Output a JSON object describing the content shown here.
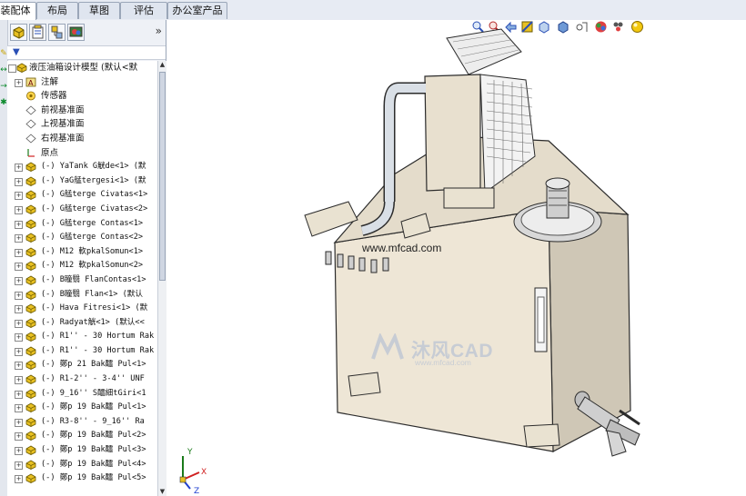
{
  "tabs": [
    {
      "label": "装配体"
    },
    {
      "label": "布局"
    },
    {
      "label": "草图"
    },
    {
      "label": "评估"
    },
    {
      "label": "办公室产品"
    }
  ],
  "panel": {
    "root_label": "液压油箱设计模型  (默认<默",
    "expand_symbol": "»"
  },
  "tree": [
    {
      "type": "annot",
      "label": "注解"
    },
    {
      "type": "sensor",
      "label": "传感器"
    },
    {
      "type": "plane",
      "label": "前视基准面"
    },
    {
      "type": "plane",
      "label": "上视基准面"
    },
    {
      "type": "plane",
      "label": "右视基准面"
    },
    {
      "type": "origin",
      "label": "原点"
    },
    {
      "type": "part",
      "label": "(-) YaTank G觥de<1> (默"
    },
    {
      "type": "part",
      "label": "(-) YaG艋tergesi<1> (默"
    },
    {
      "type": "part",
      "label": "(-) G艋terge Civatas<1>"
    },
    {
      "type": "part",
      "label": "(-) G艋terge Civatas<2>"
    },
    {
      "type": "part",
      "label": "(-) G艋terge Contas<1>"
    },
    {
      "type": "part",
      "label": "(-) G艋terge Contas<2>"
    },
    {
      "type": "part",
      "label": "(-) M12 軟pkalSomun<1>"
    },
    {
      "type": "part",
      "label": "(-) M12 軟pkalSomun<2>"
    },
    {
      "type": "part",
      "label": "(-) B瞳翳 FlanContas<1>"
    },
    {
      "type": "part",
      "label": "(-) B瞳翳 Flan<1> (默认"
    },
    {
      "type": "part",
      "label": "(-) Hava Fitresi<1> (默"
    },
    {
      "type": "part",
      "label": "(-) Radyat觥<1> (默认<<"
    },
    {
      "type": "part",
      "label": "(-) R1'' - 30 Hortum Rak"
    },
    {
      "type": "part",
      "label": "(-) R1'' - 30 Hortum Rak"
    },
    {
      "type": "part",
      "label": "(-) 鄭p 21 Bak醽 Pul<1>"
    },
    {
      "type": "part",
      "label": "(-) R1-2'' - 3-4'' UNF"
    },
    {
      "type": "part",
      "label": "(-) 9_16'' S醽細tGiri<1"
    },
    {
      "type": "part",
      "label": "(-) 鄭p 19 Bak醽 Pul<1>"
    },
    {
      "type": "part",
      "label": "(-) R3-8'' - 9_16''  Ra"
    },
    {
      "type": "part",
      "label": "(-) 鄭p 19 Bak醽 Pul<2>"
    },
    {
      "type": "part",
      "label": "(-) 鄭p 19 Bak醽 Pul<3>"
    },
    {
      "type": "part",
      "label": "(-) 鄭p 19 Bak醽 Pul<4>"
    },
    {
      "type": "part",
      "label": "(-) 鄭p 19 Bak醽 Pul<5>"
    }
  ],
  "viewport": {
    "watermark_text": "沐风CAD",
    "watermark_url": "www.mfcad.com",
    "center_url": "www.mfcad.com",
    "triad_labels": {
      "x": "X",
      "y": "Y",
      "z": "Z"
    }
  },
  "colors": {
    "tank_body": "#eee6d6",
    "tank_shadow": "#cfc7b6",
    "pipe": "#d9dfe6",
    "tree_icon_part": "#e8c022",
    "filter_icon": "#2a4fb5"
  },
  "icons": [
    "zoom-to-fit-icon",
    "zoom-area-icon",
    "previous-view-icon",
    "section-view-icon",
    "view-orientation-icon",
    "display-style-icon",
    "hide-show-icon",
    "appearance-icon",
    "scene-icon",
    "render-icon"
  ]
}
